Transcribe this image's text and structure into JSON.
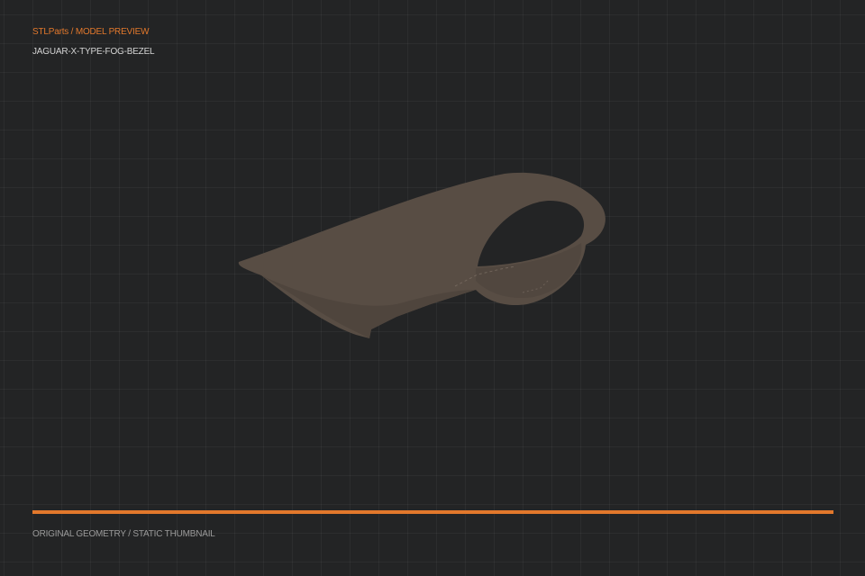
{
  "header": {
    "breadcrumb": "STLParts / MODEL PREVIEW",
    "part_name": "JAGUAR-X-TYPE-FOG-BEZEL"
  },
  "footer": {
    "caption": "ORIGINAL GEOMETRY / STATIC THUMBNAIL"
  },
  "colors": {
    "background": "#232425",
    "accent": "#e2782c",
    "title_text": "#d4d4d4",
    "caption_text": "#9a9a9a",
    "model_fill": "#584d44",
    "model_shadow": "#4a4039",
    "model_highlight": "#6e6258",
    "model_hole": "#232425"
  },
  "model": {
    "name": "fog-bezel-3d-model"
  }
}
